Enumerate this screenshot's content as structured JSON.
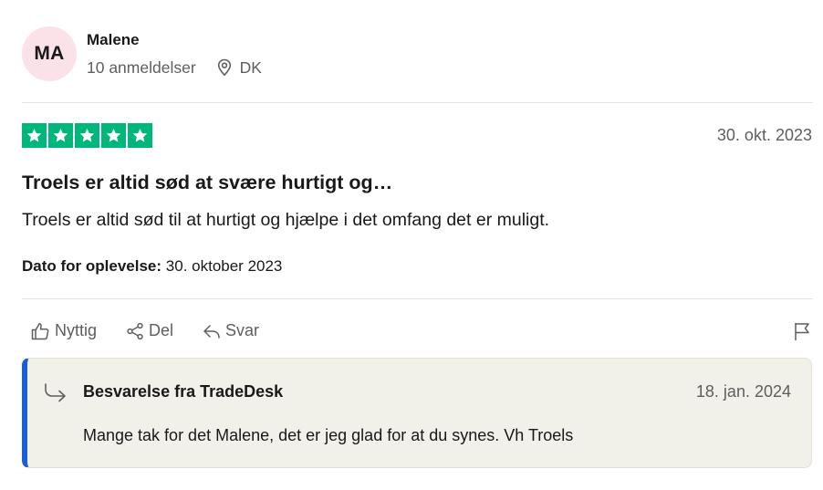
{
  "consumer": {
    "initials": "MA",
    "name": "Malene",
    "reviews_count": "10 anmeldelser",
    "country": "DK"
  },
  "review": {
    "rating": 5,
    "date": "30. okt. 2023",
    "title": "Troels er altid sød at svære hurtigt og…",
    "text": "Troels er altid sød til at hurtigt og hjælpe i det omfang det er muligt.",
    "experience_label": "Dato for oplevelse:",
    "experience_date": "30. oktober 2023"
  },
  "actions": {
    "useful": "Nyttig",
    "share": "Del",
    "reply": "Svar"
  },
  "reply": {
    "title": "Besvarelse fra TradeDesk",
    "date": "18. jan. 2024",
    "text": "Mange tak for det Malene, det er jeg glad for at du synes. Vh Troels"
  },
  "colors": {
    "star_green": "#00b67a",
    "reply_accent": "#1c5ed6",
    "reply_bg": "#f1f0e9",
    "avatar_bg": "#fbe1e8"
  },
  "icons": {
    "location": "location-pin-icon",
    "useful": "thumbs-up-icon",
    "share": "share-icon",
    "reply": "reply-arrow-icon",
    "flag": "flag-icon",
    "reply_marker": "reply-curved-arrow-icon"
  }
}
